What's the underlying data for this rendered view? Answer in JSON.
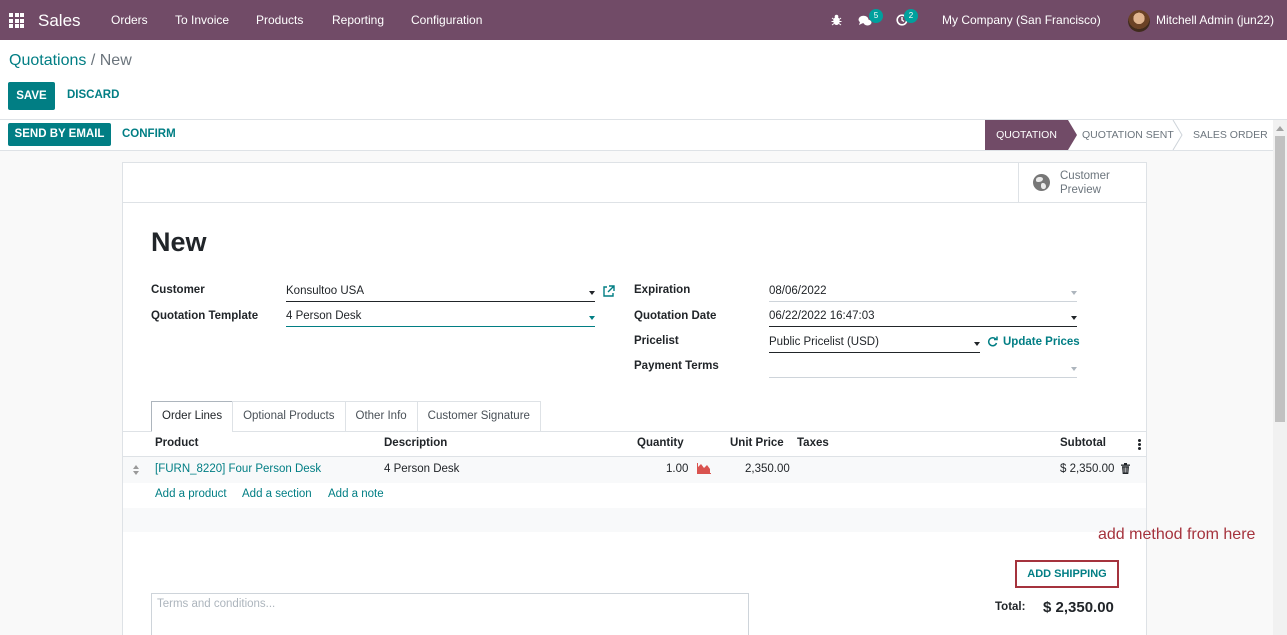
{
  "navbar": {
    "brand": "Sales",
    "menu": [
      "Orders",
      "To Invoice",
      "Products",
      "Reporting",
      "Configuration"
    ],
    "messages_count": "5",
    "activities_count": "2",
    "company": "My Company (San Francisco)",
    "user": "Mitchell Admin (jun22)",
    "color": "#714b67"
  },
  "breadcrumb": {
    "parent": "Quotations",
    "separator": "/",
    "current": "New"
  },
  "control": {
    "save": "SAVE",
    "discard": "DISCARD"
  },
  "statusbar": {
    "send_by_email": "SEND BY EMAIL",
    "confirm": "CONFIRM",
    "steps": [
      "QUOTATION",
      "QUOTATION SENT",
      "SALES ORDER"
    ],
    "active_step": "QUOTATION"
  },
  "smart_button": {
    "line1": "Customer",
    "line2": "Preview",
    "icon": "globe-icon"
  },
  "form": {
    "title": "New",
    "customer_label": "Customer",
    "customer_value": "Konsultoo USA",
    "template_label": "Quotation Template",
    "template_value": "4 Person Desk",
    "expiration_label": "Expiration",
    "expiration_value": "08/06/2022",
    "quotation_date_label": "Quotation Date",
    "quotation_date_value": "06/22/2022 16:47:03",
    "pricelist_label": "Pricelist",
    "pricelist_value": "Public Pricelist (USD)",
    "update_prices": "Update Prices",
    "payment_terms_label": "Payment Terms",
    "payment_terms_value": ""
  },
  "tabs": [
    "Order Lines",
    "Optional Products",
    "Other Info",
    "Customer Signature"
  ],
  "table": {
    "columns": [
      "Product",
      "Description",
      "Quantity",
      "Unit Price",
      "Taxes",
      "Subtotal"
    ],
    "rows": [
      {
        "product": "[FURN_8220] Four Person Desk",
        "description": "4 Person Desk",
        "quantity": "1.00",
        "unit_price": "2,350.00",
        "taxes": "",
        "subtotal": "$ 2,350.00"
      }
    ],
    "add_product": "Add a product",
    "add_section": "Add a section",
    "add_note": "Add a note"
  },
  "footer": {
    "terms_placeholder": "Terms and conditions...",
    "add_shipping": "ADD SHIPPING",
    "total_label": "Total:",
    "total_value": "$ 2,350.00"
  },
  "annotation": "add method from here"
}
